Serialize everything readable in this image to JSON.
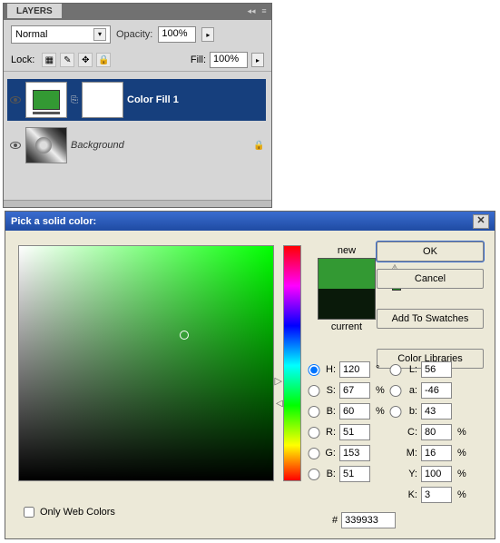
{
  "layers_panel": {
    "title": "LAYERS",
    "blend_mode": "Normal",
    "opacity_label": "Opacity:",
    "opacity_value": "100%",
    "fill_label": "Fill:",
    "fill_value": "100%",
    "lock_label": "Lock:",
    "layers": [
      {
        "name": "Color Fill 1",
        "selected": true,
        "visible": true,
        "locked": false,
        "has_mask": true
      },
      {
        "name": "Background",
        "selected": false,
        "visible": true,
        "locked": true,
        "has_mask": false
      }
    ]
  },
  "color_picker": {
    "title": "Pick a solid color:",
    "new_label": "new",
    "current_label": "current",
    "new_color": "#339933",
    "current_color": "#0a1a0a",
    "buttons": {
      "ok": "OK",
      "cancel": "Cancel",
      "add_swatch": "Add To Swatches",
      "libraries": "Color Libraries"
    },
    "hsb": {
      "h_label": "H:",
      "h": "120",
      "h_unit": "°",
      "s_label": "S:",
      "s": "67",
      "s_unit": "%",
      "b_label": "B:",
      "b": "60",
      "b_unit": "%"
    },
    "lab": {
      "l_label": "L:",
      "l": "56",
      "a_label": "a:",
      "a": "-46",
      "b_label": "b:",
      "b": "43"
    },
    "rgb": {
      "r_label": "R:",
      "r": "51",
      "g_label": "G:",
      "g": "153",
      "b_label": "B:",
      "b": "51"
    },
    "cmyk": {
      "c_label": "C:",
      "c": "80",
      "m_label": "M:",
      "m": "16",
      "y_label": "Y:",
      "y": "100",
      "k_label": "K:",
      "k": "3",
      "unit": "%"
    },
    "hex_label": "#",
    "hex": "339933",
    "web_colors_label": "Only Web Colors"
  }
}
